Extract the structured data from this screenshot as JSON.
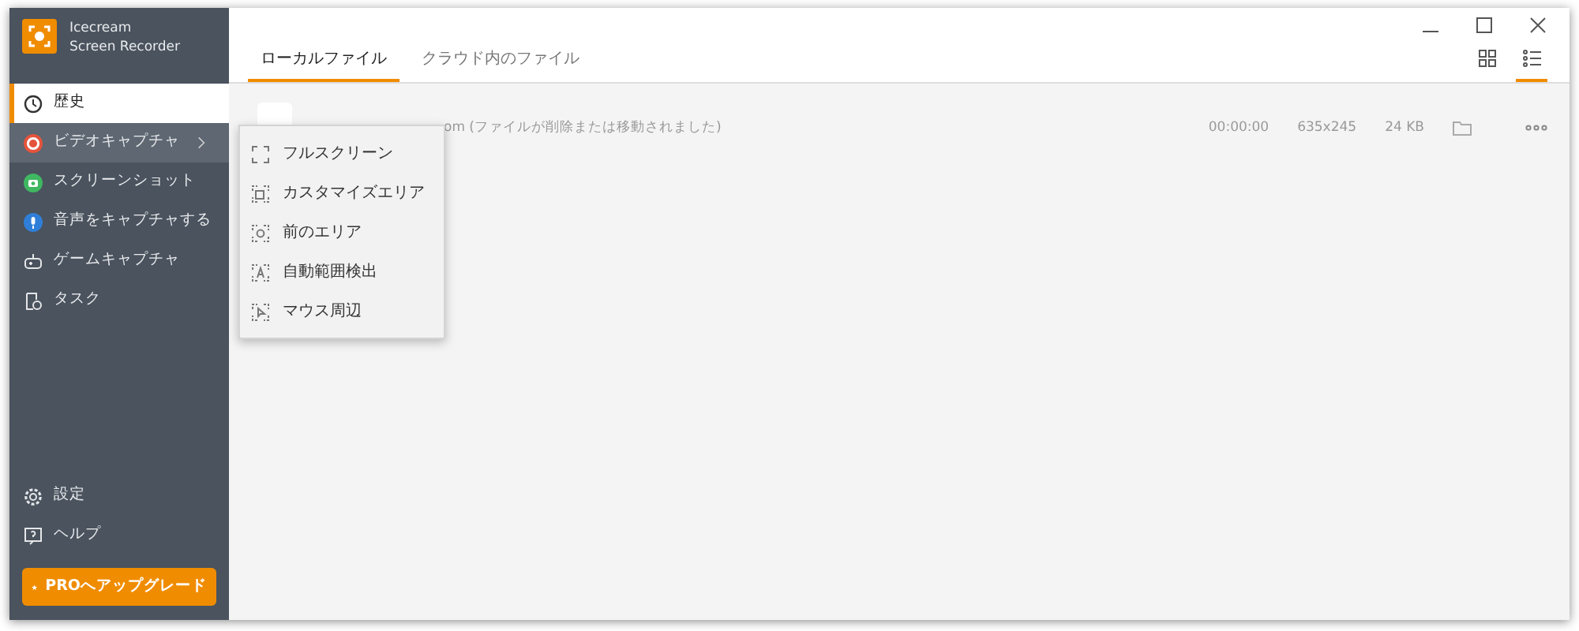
{
  "app": {
    "name_line_1": "Icecream",
    "name_line_2": "Screen Recorder"
  },
  "sidebar": {
    "items": [
      {
        "label": "歴史",
        "selected": true,
        "expanded": false,
        "kind": "link"
      },
      {
        "label": "ビデオキャプチャ",
        "selected": false,
        "expanded": true,
        "kind": "submenu"
      },
      {
        "label": "スクリーンショット",
        "selected": false,
        "expanded": false,
        "kind": "submenu"
      },
      {
        "label": "音声をキャプチャする",
        "selected": false,
        "expanded": false,
        "kind": "submenu"
      },
      {
        "label": "ゲームキャプチャ",
        "selected": false,
        "expanded": false,
        "kind": "link"
      },
      {
        "label": "タスク",
        "selected": false,
        "expanded": false,
        "kind": "link"
      }
    ],
    "bottom_items": [
      {
        "label": "設定"
      },
      {
        "label": "ヘルプ"
      }
    ],
    "upgrade_button": "PROへアップグレード"
  },
  "tabs": [
    {
      "label": "ローカルファイル",
      "selected": true
    },
    {
      "label": "クラウド内のファイル",
      "selected": false
    }
  ],
  "view_modes": [
    {
      "selected": false
    },
    {
      "selected": true
    }
  ],
  "files": [
    {
      "name": "om (ファイルが削除または移動されました)",
      "duration": "00:00:00",
      "resolution": "635x245",
      "size": "24 KB"
    }
  ],
  "submenu": [
    {
      "label": "フルスクリーン"
    },
    {
      "label": "カスタマイズエリア"
    },
    {
      "label": "前のエリア"
    },
    {
      "label": "自動範囲検出"
    },
    {
      "label": "マウス周辺"
    }
  ]
}
